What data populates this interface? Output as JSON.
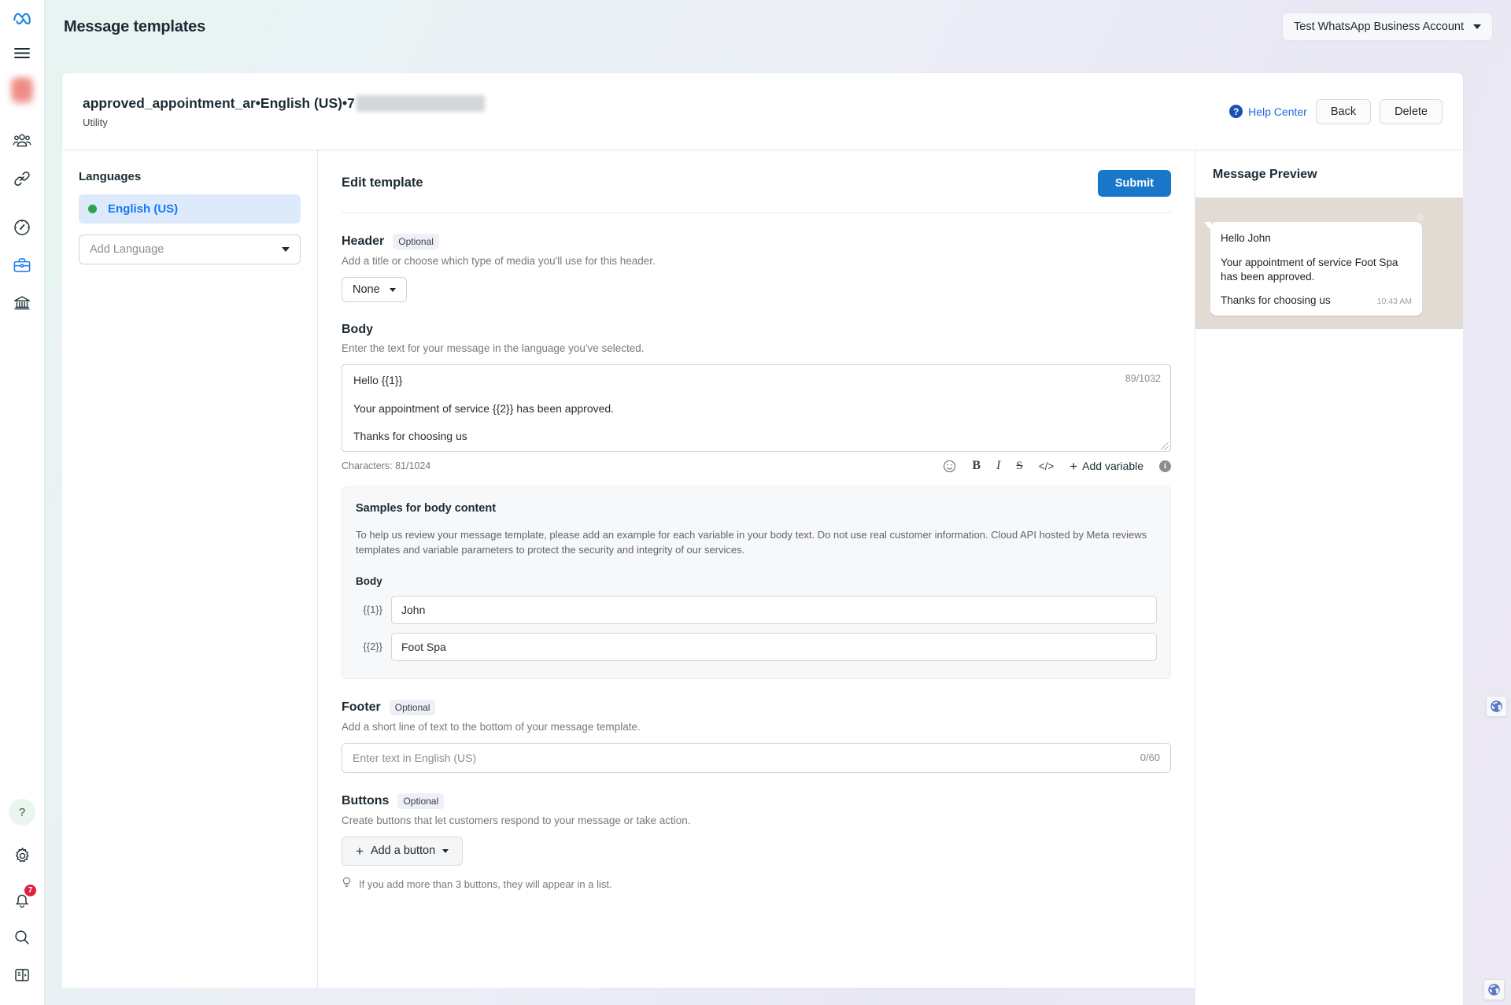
{
  "app": {
    "logo": "meta-logo",
    "page_title": "Message templates",
    "account_selector": "Test WhatsApp Business Account"
  },
  "rail": {
    "items": [
      {
        "icon": "hamburger-menu-icon",
        "name": "menu"
      },
      {
        "icon": "avatar-icon",
        "name": "account-avatar"
      },
      {
        "icon": "people-icon",
        "name": "users"
      },
      {
        "icon": "link-icon",
        "name": "links"
      },
      {
        "icon": "gauge-icon",
        "name": "performance"
      },
      {
        "icon": "briefcase-icon",
        "name": "business",
        "active": true
      },
      {
        "icon": "bank-icon",
        "name": "billing"
      }
    ],
    "bottom_items": [
      {
        "icon": "help-icon",
        "name": "help"
      },
      {
        "icon": "gear-icon",
        "name": "settings"
      },
      {
        "icon": "bell-icon",
        "name": "notifications",
        "badge": "7"
      },
      {
        "icon": "search-icon",
        "name": "search"
      },
      {
        "icon": "panel-icon",
        "name": "toggle-panel"
      }
    ],
    "notification_badge": "7"
  },
  "template_header": {
    "name": "approved_appointment_ar",
    "separator": " • ",
    "language": "English (US)",
    "id_prefix": "7",
    "category": "Utility",
    "help_center": "Help Center",
    "back": "Back",
    "delete": "Delete"
  },
  "languages": {
    "heading": "Languages",
    "selected": "English (US)",
    "add_placeholder": "Add Language"
  },
  "editor": {
    "heading": "Edit template",
    "submit": "Submit",
    "header": {
      "title": "Header",
      "optional": "Optional",
      "description": "Add a title or choose which type of media you'll use for this header.",
      "type_value": "None"
    },
    "body": {
      "title": "Body",
      "description": "Enter the text for your message in the language you've selected.",
      "lines": [
        "Hello {{1}}",
        "Your appointment of service {{2}} has been approved.",
        "Thanks for choosing us"
      ],
      "inner_counter": "89/1032",
      "characters_label": "Characters: 81/1024",
      "toolbar": {
        "emoji": "emoji-icon",
        "bold": "B",
        "italic": "I",
        "strikethrough": "S",
        "code": "</>",
        "add_variable": "Add variable",
        "info": "info-icon"
      }
    },
    "samples": {
      "title": "Samples for body content",
      "description": "To help us review your message template, please add an example for each variable in your body text. Do not use real customer information. Cloud API hosted by Meta reviews templates and variable parameters to protect the security and integrity of our services.",
      "body_label": "Body",
      "variables": [
        {
          "key": "{{1}}",
          "value": "John"
        },
        {
          "key": "{{2}}",
          "value": "Foot Spa"
        }
      ]
    },
    "footer": {
      "title": "Footer",
      "optional": "Optional",
      "description": "Add a short line of text to the bottom of your message template.",
      "placeholder": "Enter text in English (US)",
      "counter": "0/60"
    },
    "buttons": {
      "title": "Buttons",
      "optional": "Optional",
      "description": "Create buttons that let customers respond to your message or take action.",
      "add_label": "Add a button",
      "hint": "If you add more than 3 buttons, they will appear in a list."
    }
  },
  "preview": {
    "title": "Message Preview",
    "message_lines": [
      "Hello John",
      "Your appointment of service Foot Spa has been approved.",
      "Thanks for choosing us"
    ],
    "time": "10:43 AM"
  },
  "colors": {
    "accent_blue": "#1877f2",
    "submit_blue": "#1877c9",
    "status_green": "#31a24c",
    "badge_red": "#e41e3f",
    "selected_bg": "#dceafc"
  },
  "floating": {
    "globe_right": "globe-icon",
    "globe_bottom": "globe-icon"
  }
}
